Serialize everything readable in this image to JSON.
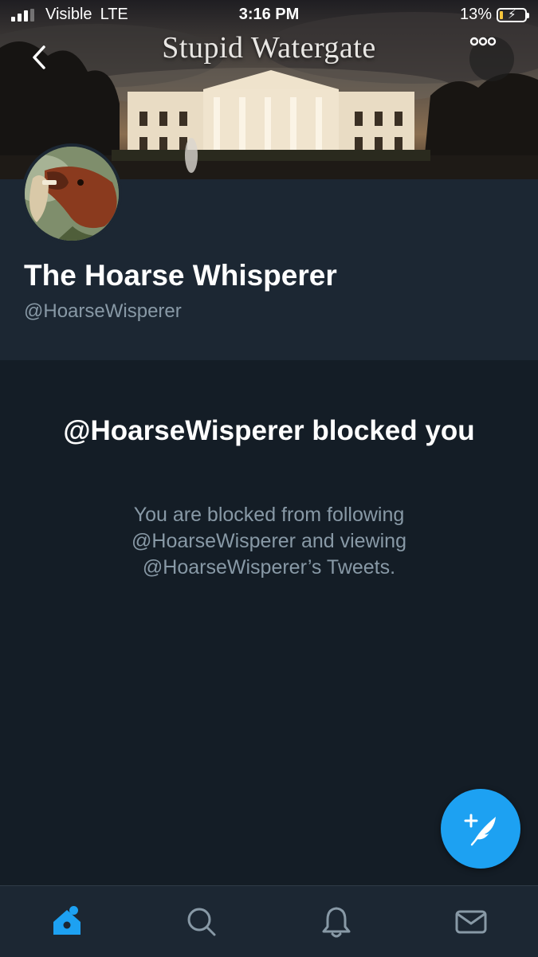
{
  "status_bar": {
    "carrier": "Visible",
    "network": "LTE",
    "time": "3:16 PM",
    "battery_percent": "13%",
    "battery_level": 0.13
  },
  "header": {
    "banner_caption": "Stupid Watergate",
    "back_icon": "chevron-left-icon",
    "more_icon": "more-dots-icon"
  },
  "profile": {
    "display_name": "The Hoarse Whisperer",
    "handle": "@HoarseWisperer"
  },
  "blocked": {
    "title": "@HoarseWisperer blocked you",
    "message": "You are blocked from following @HoarseWisperer and viewing @HoarseWisperer’s Tweets."
  },
  "compose": {
    "icon": "compose-feather-icon"
  },
  "tab_bar": {
    "tabs": [
      {
        "name": "home",
        "icon": "home-icon",
        "active": true
      },
      {
        "name": "search",
        "icon": "search-icon",
        "active": false
      },
      {
        "name": "notifications",
        "icon": "bell-icon",
        "active": false
      },
      {
        "name": "messages",
        "icon": "mail-icon",
        "active": false
      }
    ]
  },
  "colors": {
    "background": "#141d26",
    "panel": "#1c2733",
    "accent": "#1da1f2",
    "secondary_text": "#8899a6"
  }
}
